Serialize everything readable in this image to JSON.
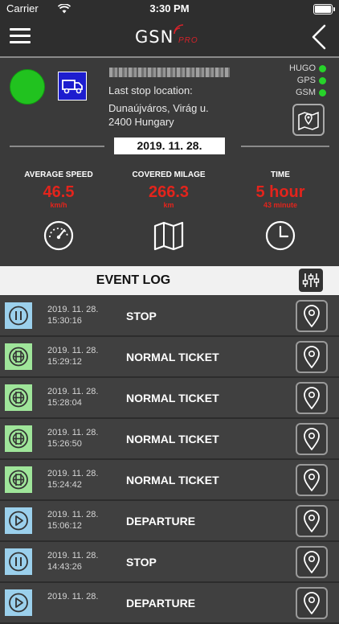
{
  "status_bar": {
    "carrier": "Carrier",
    "time": "3:30 PM"
  },
  "nav": {
    "logo_main": "GSN",
    "logo_sub": "PRO"
  },
  "vehicle": {
    "last_stop_label": "Last stop location:",
    "address_line1": "Dunaújváros, Virág u.",
    "address_line2": "2400 Hungary",
    "indicators": [
      {
        "label": "HUGO"
      },
      {
        "label": "GPS"
      },
      {
        "label": "GSM"
      }
    ],
    "date": "2019. 11. 28."
  },
  "stats": [
    {
      "label": "AVERAGE SPEED",
      "value": "46.5",
      "unit": "km/h",
      "icon": "speedometer-icon"
    },
    {
      "label": "COVERED MILAGE",
      "value": "266.3",
      "unit": "km",
      "icon": "map-icon"
    },
    {
      "label": "TIME",
      "value": "5 hour",
      "unit": "43 minute",
      "icon": "clock-icon"
    }
  ],
  "event_log": {
    "title": "EVENT LOG",
    "events": [
      {
        "date": "2019. 11. 28.",
        "time": "15:30:16",
        "type": "STOP",
        "icon": "pause-icon"
      },
      {
        "date": "2019. 11. 28.",
        "time": "15:29:12",
        "type": "NORMAL TICKET",
        "icon": "ticket-icon"
      },
      {
        "date": "2019. 11. 28.",
        "time": "15:28:04",
        "type": "NORMAL TICKET",
        "icon": "ticket-icon"
      },
      {
        "date": "2019. 11. 28.",
        "time": "15:26:50",
        "type": "NORMAL TICKET",
        "icon": "ticket-icon"
      },
      {
        "date": "2019. 11. 28.",
        "time": "15:24:42",
        "type": "NORMAL TICKET",
        "icon": "ticket-icon"
      },
      {
        "date": "2019. 11. 28.",
        "time": "15:06:12",
        "type": "DEPARTURE",
        "icon": "play-icon"
      },
      {
        "date": "2019. 11. 28.",
        "time": "14:43:26",
        "type": "STOP",
        "icon": "pause-icon"
      },
      {
        "date": "2019. 11. 28.",
        "time": "",
        "type": "DEPARTURE",
        "icon": "play-icon"
      }
    ]
  }
}
